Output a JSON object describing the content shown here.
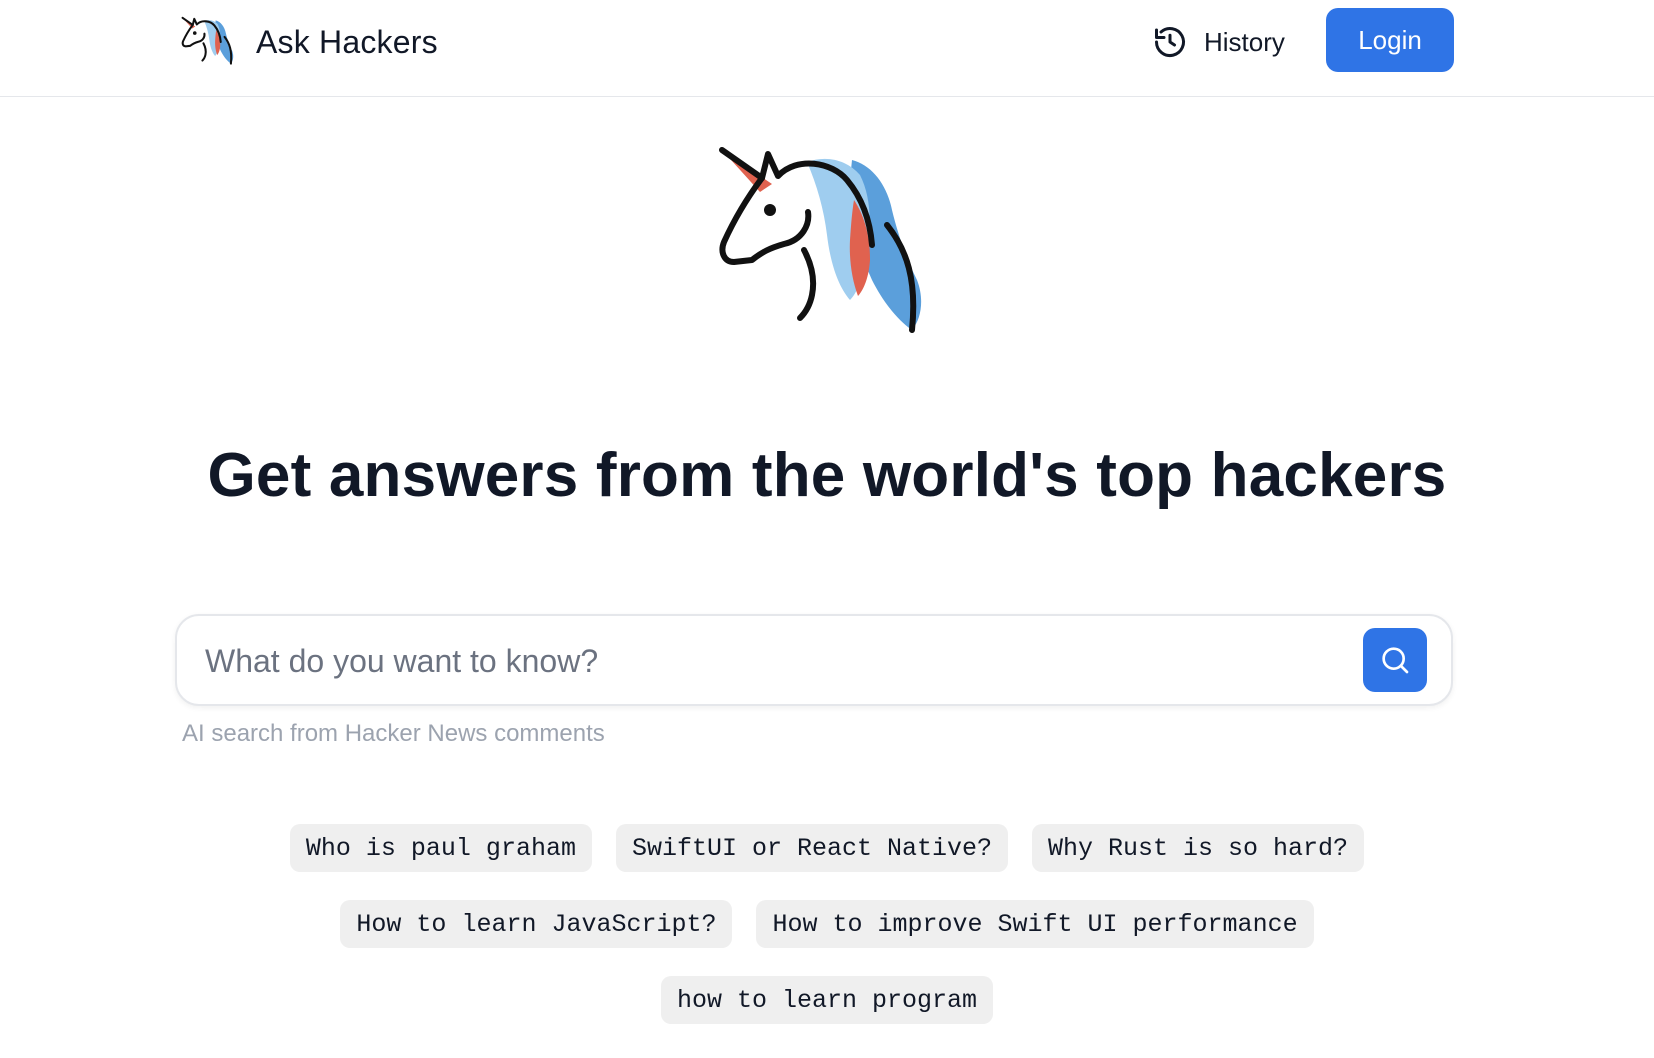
{
  "header": {
    "brand_name": "Ask Hackers",
    "logo_icon": "unicorn-icon",
    "history_label": "History",
    "history_icon": "history-icon",
    "login_label": "Login"
  },
  "hero": {
    "logo_icon": "unicorn-icon",
    "headline": "Get answers from the world's top hackers"
  },
  "search": {
    "placeholder": "What do you want to know?",
    "value": "",
    "button_icon": "search-icon",
    "caption": "AI search from Hacker News comments"
  },
  "suggestions": [
    "Who is paul graham",
    "SwiftUI or React Native?",
    "Why Rust is so hard?",
    "How to learn JavaScript?",
    "How to improve Swift UI performance",
    "how to learn program"
  ],
  "colors": {
    "accent": "#2f74e6",
    "chip_bg": "#efefef",
    "text": "#111827",
    "muted": "#9ca3af",
    "unicorn_horn": "#e0624f",
    "unicorn_mane_light": "#9fcdef",
    "unicorn_mane_dark": "#5b9fdb"
  }
}
